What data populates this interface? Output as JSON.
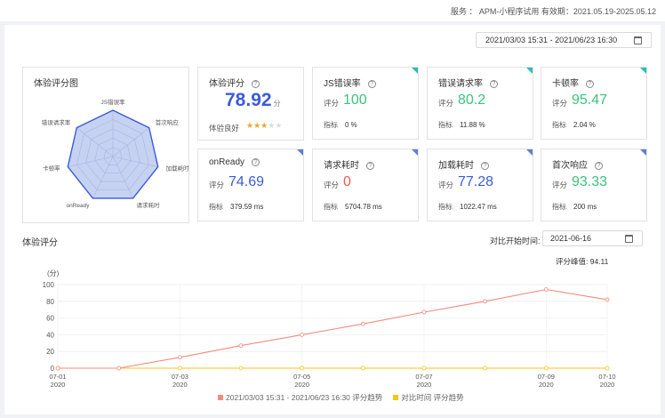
{
  "header": {
    "service_text": "服务 ： APM-小程序试用 有效期：2021.05.19-2025.05.12"
  },
  "date_range": "2021/03/03 15:31 - 2021/06/23 16:30",
  "radar": {
    "title": "体验评分图",
    "axes": [
      "JS错误率",
      "首次响应",
      "加载耗时",
      "请求耗时",
      "onReady",
      "卡顿率",
      "错误请求率"
    ]
  },
  "score": {
    "title": "体验评分",
    "value": "78.92",
    "unit": "分",
    "quality_label": "体验良好",
    "stars": 3,
    "max_stars": 5
  },
  "metrics": [
    {
      "title": "JS错误率",
      "score_label": "评分",
      "score": "100",
      "color": "#3cc47c",
      "ind_label": "指标",
      "ind": "0 %",
      "corner": "#2bbfb3"
    },
    {
      "title": "错误请求率",
      "score_label": "评分",
      "score": "80.2",
      "color": "#3cc47c",
      "ind_label": "指标",
      "ind": "11.88 %",
      "corner": "#2bbfb3"
    },
    {
      "title": "卡顿率",
      "score_label": "评分",
      "score": "95.47",
      "color": "#3cc47c",
      "ind_label": "指标",
      "ind": "2.04 %",
      "corner": "#2bbfb3"
    },
    {
      "title": "onReady",
      "score_label": "评分",
      "score": "74.69",
      "color": "#3b5bdb",
      "ind_label": "指标",
      "ind": "379.59 ms",
      "corner": "#5b7fd6"
    },
    {
      "title": "请求耗时",
      "score_label": "评分",
      "score": "0",
      "color": "#f25b4e",
      "ind_label": "指标",
      "ind": "5704.78 ms",
      "corner": "#5b7fd6"
    },
    {
      "title": "加载耗时",
      "score_label": "评分",
      "score": "77.28",
      "color": "#3b5bdb",
      "ind_label": "指标",
      "ind": "1022.47 ms",
      "corner": "#5b7fd6"
    },
    {
      "title": "首次响应",
      "score_label": "评分",
      "score": "93.33",
      "color": "#3cc47c",
      "ind_label": "指标",
      "ind": "200 ms",
      "corner": "#5b7fd6"
    }
  ],
  "trend": {
    "title": "体验评分",
    "compare_label": "对比开始时间:",
    "compare_date": "2021-06-16",
    "peak_text": "评分峰值:  94.11"
  },
  "chart_data": {
    "type": "line",
    "ylabel": "(分)",
    "ylim": [
      0,
      100
    ],
    "yticks": [
      0,
      20,
      40,
      60,
      80,
      100
    ],
    "x_ticks": [
      {
        "date": "07-01",
        "year": "2020",
        "x": 0
      },
      {
        "date": "07-03",
        "year": "2020",
        "x": 2
      },
      {
        "date": "07-05",
        "year": "2020",
        "x": 4
      },
      {
        "date": "07-07",
        "year": "2020",
        "x": 6
      },
      {
        "date": "07-09",
        "year": "2020",
        "x": 8
      },
      {
        "date": "07-10",
        "year": "2020",
        "x": 9
      }
    ],
    "series": [
      {
        "name": "2021/03/03 15:31 - 2021/06/23 16:30 评分趋势",
        "color": "#f28b7c",
        "x": [
          0,
          1,
          2,
          3,
          4,
          5,
          6,
          7,
          8,
          9
        ],
        "values": [
          0,
          0,
          13,
          27,
          40,
          53,
          67,
          80,
          94.11,
          82
        ]
      },
      {
        "name": "对比时间 评分趋势",
        "color": "#f5c518",
        "x": [
          0,
          1,
          2,
          3,
          4,
          5,
          6,
          7,
          8,
          9
        ],
        "values": [
          0,
          0,
          0,
          0,
          0,
          0,
          0,
          0,
          0,
          0
        ]
      }
    ]
  }
}
